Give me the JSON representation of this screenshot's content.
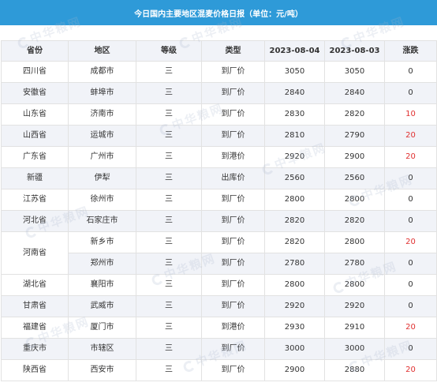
{
  "title": "今日国内主要地区混麦价格日报（单位：元/吨）",
  "headers": [
    "省份",
    "地区",
    "等级",
    "类型",
    "2023-08-04",
    "2023-08-03",
    "涨跌"
  ],
  "rows": [
    {
      "province": "四川省",
      "region": "成都市",
      "grade": "三",
      "type": "到厂价",
      "d1": "3050",
      "d2": "3050",
      "change": "0"
    },
    {
      "province": "安徽省",
      "region": "蚌埠市",
      "grade": "三",
      "type": "到厂价",
      "d1": "2840",
      "d2": "2840",
      "change": "0"
    },
    {
      "province": "山东省",
      "region": "济南市",
      "grade": "三",
      "type": "到厂价",
      "d1": "2830",
      "d2": "2820",
      "change": "10"
    },
    {
      "province": "山西省",
      "region": "运城市",
      "grade": "三",
      "type": "到厂价",
      "d1": "2810",
      "d2": "2790",
      "change": "20"
    },
    {
      "province": "广东省",
      "region": "广州市",
      "grade": "三",
      "type": "到港价",
      "d1": "2920",
      "d2": "2900",
      "change": "20"
    },
    {
      "province": "新疆",
      "region": "伊犁",
      "grade": "三",
      "type": "出库价",
      "d1": "2560",
      "d2": "2560",
      "change": "0"
    },
    {
      "province": "江苏省",
      "region": "徐州市",
      "grade": "三",
      "type": "到厂价",
      "d1": "2800",
      "d2": "2800",
      "change": "0"
    },
    {
      "province": "河北省",
      "region": "石家庄市",
      "grade": "三",
      "type": "到厂价",
      "d1": "2820",
      "d2": "2820",
      "change": "0"
    },
    {
      "province": "河南省",
      "region": "新乡市",
      "grade": "三",
      "type": "到厂价",
      "d1": "2820",
      "d2": "2800",
      "change": "20"
    },
    {
      "province": "",
      "region": "郑州市",
      "grade": "三",
      "type": "到厂价",
      "d1": "2780",
      "d2": "2780",
      "change": "0"
    },
    {
      "province": "湖北省",
      "region": "襄阳市",
      "grade": "三",
      "type": "到厂价",
      "d1": "2800",
      "d2": "2800",
      "change": "0"
    },
    {
      "province": "甘肃省",
      "region": "武威市",
      "grade": "三",
      "type": "到厂价",
      "d1": "2920",
      "d2": "2920",
      "change": "0"
    },
    {
      "province": "福建省",
      "region": "厦门市",
      "grade": "三",
      "type": "到港价",
      "d1": "2930",
      "d2": "2910",
      "change": "20"
    },
    {
      "province": "重庆市",
      "region": "市辖区",
      "grade": "三",
      "type": "到厂价",
      "d1": "3000",
      "d2": "3000",
      "change": "0"
    },
    {
      "province": "陕西省",
      "region": "西安市",
      "grade": "三",
      "type": "到厂价",
      "d1": "2900",
      "d2": "2880",
      "change": "20"
    }
  ],
  "watermark": "中华粮网",
  "colors": {
    "header_bar": "#2e9ad8",
    "stripe": "#f1f3f8",
    "up": "#e03030"
  }
}
